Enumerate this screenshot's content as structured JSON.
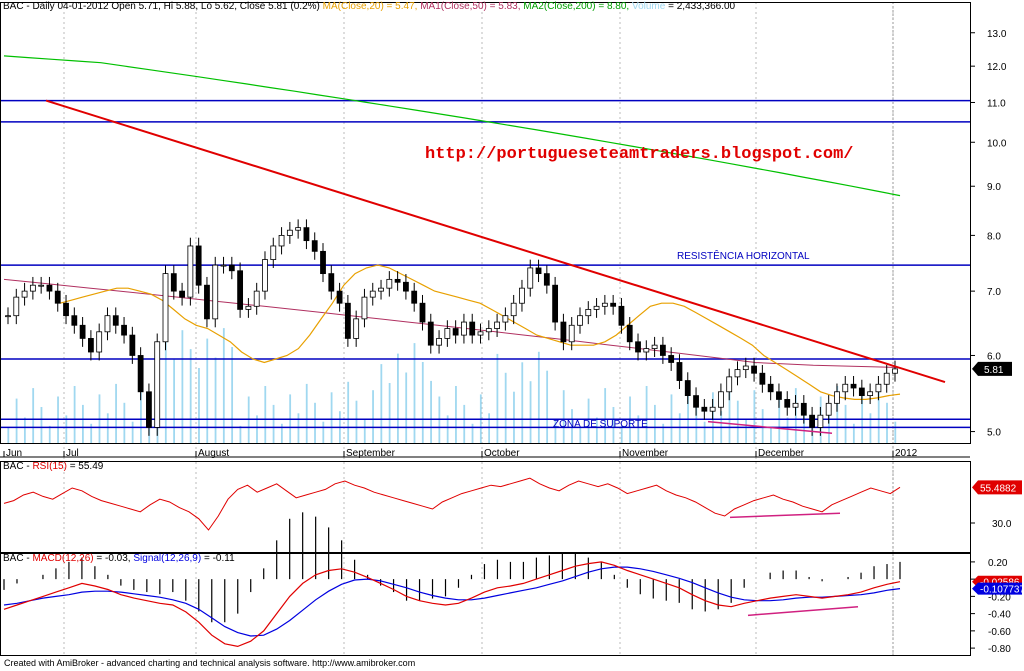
{
  "header": {
    "price_prefix": "BAC - Daily 04-01-2012 Open 5.71, Hi 5.88, Lo 5.62, Close 5.81 (0.2%)",
    "ma20": "MA(Close,20) = 5.47,",
    "ma50": "MA1(Close,50) = 5.83,",
    "ma200": "MA2(Close,200) = 8.80,",
    "volume_label": "Volume",
    "volume_value": "= 2,433,366.00",
    "rsi_prefix": "BAC -",
    "rsi_label": "RSI(15)",
    "rsi_value": "= 55.49",
    "macd_prefix": "BAC -",
    "macd_label": "MACD(12,26)",
    "macd_value": "= -0.03,",
    "signal_label": "Signal(12,26,9)",
    "signal_value": "= -0.11"
  },
  "footer_text": "Created with AmiBroker - advanced charting and technical analysis software. http://www.amibroker.com",
  "colors": {
    "ma20": "#e8a000",
    "ma50": "#b03060",
    "ma200": "#00c000",
    "volume": "#a0d8f0",
    "rsi": "#e00000",
    "macd": "#e00000",
    "signal": "#0000e0",
    "trendline": "#e00000",
    "levels": "#0000c0",
    "divergence": "#d02080",
    "url": "#e00000"
  },
  "chart_data": [
    {
      "type": "candlestick",
      "title": "BAC - Daily",
      "x_labels": [
        "Jun",
        "Jul",
        "August",
        "September",
        "October",
        "November",
        "December",
        "2012"
      ],
      "y_ticks": [
        "13.0",
        "12.0",
        "11.0",
        "10.0",
        "9.0",
        "8.0",
        "7.0",
        "6.0",
        "5.0"
      ],
      "y_scale": "log",
      "ylim": [
        4.9,
        13.5
      ],
      "last_close": 5.81,
      "last_value_label": "5.81",
      "close_path": [
        6.6,
        6.9,
        7.0,
        7.1,
        7.1,
        7.0,
        6.8,
        6.6,
        6.45,
        6.25,
        6.05,
        6.35,
        6.6,
        6.45,
        6.3,
        6.0,
        5.5,
        5.05,
        6.2,
        7.3,
        7.0,
        6.9,
        7.8,
        7.1,
        6.55,
        7.45,
        7.45,
        7.35,
        6.7,
        6.75,
        7.0,
        7.55,
        7.8,
        8.0,
        8.1,
        8.15,
        7.9,
        7.7,
        7.3,
        7.0,
        6.8,
        6.25,
        6.55,
        6.9,
        7.0,
        7.05,
        7.2,
        7.15,
        7.0,
        6.8,
        6.5,
        6.15,
        6.25,
        6.4,
        6.3,
        6.5,
        6.3,
        6.35,
        6.4,
        6.5,
        6.6,
        6.8,
        7.05,
        7.4,
        7.3,
        7.1,
        6.5,
        6.2,
        6.45,
        6.6,
        6.7,
        6.75,
        6.8,
        6.75,
        6.45,
        6.2,
        6.05,
        6.1,
        6.15,
        6.0,
        5.9,
        5.65,
        5.45,
        5.3,
        5.25,
        5.3,
        5.5,
        5.7,
        5.8,
        5.85,
        5.75,
        5.6,
        5.5,
        5.4,
        5.3,
        5.35,
        5.2,
        5.05,
        5.2,
        5.35,
        5.5,
        5.6,
        5.55,
        5.45,
        5.5,
        5.6,
        5.75,
        5.81
      ],
      "ma20_path": [
        6.8,
        6.85,
        6.9,
        6.95,
        7.0,
        7.05,
        7.05,
        7.0,
        6.95,
        6.85,
        6.7,
        6.55,
        6.45,
        6.4,
        6.3,
        6.2,
        6.05,
        5.95,
        5.9,
        5.95,
        6.0,
        6.1,
        6.3,
        6.55,
        6.8,
        7.1,
        7.3,
        7.4,
        7.45,
        7.4,
        7.3,
        7.2,
        7.1,
        7.0,
        6.95,
        6.9,
        6.85,
        6.8,
        6.7,
        6.6,
        6.5,
        6.4,
        6.3,
        6.25,
        6.2,
        6.15,
        6.15,
        6.15,
        6.2,
        6.3,
        6.45,
        6.6,
        6.75,
        6.8,
        6.8,
        6.75,
        6.65,
        6.55,
        6.45,
        6.35,
        6.25,
        6.15,
        6.0,
        5.9,
        5.8,
        5.7,
        5.6,
        5.5,
        5.45,
        5.42,
        5.4,
        5.4,
        5.42,
        5.45,
        5.47
      ],
      "ma50_path": [
        7.2,
        7.15,
        7.1,
        7.05,
        7.0,
        6.95,
        6.9,
        6.85,
        6.8,
        6.75,
        6.7,
        6.65,
        6.6,
        6.55,
        6.5,
        6.45,
        6.4,
        6.35,
        6.3,
        6.25,
        6.2,
        6.15,
        6.1,
        6.05,
        6.0,
        5.95,
        5.9,
        5.88,
        5.86,
        5.85,
        5.84,
        5.83
      ],
      "ma200_path": [
        12.3,
        12.25,
        12.2,
        12.15,
        12.1,
        12.0,
        11.9,
        11.8,
        11.7,
        11.6,
        11.5,
        11.4,
        11.3,
        11.2,
        11.1,
        11.0,
        10.9,
        10.8,
        10.7,
        10.6,
        10.5,
        10.4,
        10.3,
        10.2,
        10.1,
        10.0,
        9.9,
        9.8,
        9.7,
        9.6,
        9.5,
        9.4,
        9.3,
        9.2,
        9.1,
        9.0,
        8.9,
        8.8
      ],
      "horizontal_levels": [
        11.05,
        10.5,
        7.45,
        5.95,
        5.15,
        5.05
      ],
      "annotations": [
        {
          "text": "http://portugueseteamtraders.blogspot.com/"
        },
        {
          "text": "RESISTÊNCIA HORIZONTAL"
        },
        {
          "text": "ZONA DE SUPORTE"
        }
      ]
    },
    {
      "type": "line",
      "title": "RSI(15)",
      "series": [
        {
          "name": "RSI(15)",
          "values": [
            44,
            46,
            50,
            52,
            49,
            47,
            51,
            55,
            53,
            49,
            46,
            44,
            42,
            40,
            38,
            43,
            47,
            45,
            41,
            38,
            33,
            25,
            35,
            47,
            54,
            57,
            52,
            55,
            58,
            53,
            48,
            50,
            52,
            54,
            58,
            60,
            57,
            55,
            52,
            50,
            48,
            46,
            44,
            42,
            40,
            45,
            48,
            51,
            53,
            55,
            57,
            56,
            58,
            60,
            62,
            58,
            55,
            53,
            57,
            60,
            58,
            56,
            58,
            55,
            51,
            53,
            55,
            57,
            53,
            50,
            48,
            45,
            41,
            37,
            35,
            40,
            43,
            46,
            48,
            50,
            47,
            45,
            42,
            40,
            38,
            43,
            46,
            49,
            52,
            55,
            53,
            51,
            55.49
          ]
        }
      ],
      "y_ticks": [
        "30.0"
      ],
      "last_value_label": "55.4882"
    },
    {
      "type": "line",
      "title": "MACD(12,26)",
      "series": [
        {
          "name": "MACD(12,26)",
          "values": [
            -0.35,
            -0.3,
            -0.25,
            -0.2,
            -0.15,
            -0.1,
            -0.05,
            -0.08,
            -0.12,
            -0.18,
            -0.22,
            -0.25,
            -0.28,
            -0.3,
            -0.38,
            -0.5,
            -0.65,
            -0.75,
            -0.78,
            -0.72,
            -0.6,
            -0.4,
            -0.2,
            -0.05,
            0.05,
            0.1,
            0.12,
            0.08,
            0.02,
            -0.05,
            -0.12,
            -0.2,
            -0.25,
            -0.28,
            -0.3,
            -0.28,
            -0.22,
            -0.15,
            -0.1,
            -0.08,
            -0.05,
            0.0,
            0.05,
            0.1,
            0.15,
            0.18,
            0.2,
            0.16,
            0.1,
            0.05,
            0.0,
            -0.05,
            -0.1,
            -0.18,
            -0.25,
            -0.3,
            -0.32,
            -0.28,
            -0.25,
            -0.22,
            -0.2,
            -0.18,
            -0.2,
            -0.22,
            -0.2,
            -0.18,
            -0.15,
            -0.1,
            -0.06,
            -0.03
          ]
        },
        {
          "name": "Signal(12,26,9)",
          "values": [
            -0.3,
            -0.28,
            -0.25,
            -0.22,
            -0.2,
            -0.18,
            -0.15,
            -0.14,
            -0.14,
            -0.15,
            -0.17,
            -0.19,
            -0.21,
            -0.24,
            -0.28,
            -0.35,
            -0.45,
            -0.55,
            -0.62,
            -0.66,
            -0.65,
            -0.58,
            -0.48,
            -0.36,
            -0.24,
            -0.14,
            -0.06,
            -0.01,
            0.0,
            -0.02,
            -0.06,
            -0.1,
            -0.15,
            -0.19,
            -0.22,
            -0.24,
            -0.24,
            -0.22,
            -0.19,
            -0.16,
            -0.13,
            -0.1,
            -0.06,
            -0.02,
            0.03,
            0.08,
            0.12,
            0.14,
            0.14,
            0.12,
            0.09,
            0.05,
            0.01,
            -0.04,
            -0.1,
            -0.16,
            -0.21,
            -0.24,
            -0.25,
            -0.25,
            -0.24,
            -0.22,
            -0.21,
            -0.21,
            -0.2,
            -0.19,
            -0.18,
            -0.16,
            -0.13,
            -0.11
          ]
        }
      ],
      "y_ticks": [
        "0.20",
        "0.00",
        "-0.20",
        "-0.40",
        "-0.60",
        "-0.80"
      ],
      "ylim": [
        -0.88,
        0.28
      ],
      "last_macd_label": "-0.02586",
      "last_signal_label": "-0.107737"
    }
  ]
}
